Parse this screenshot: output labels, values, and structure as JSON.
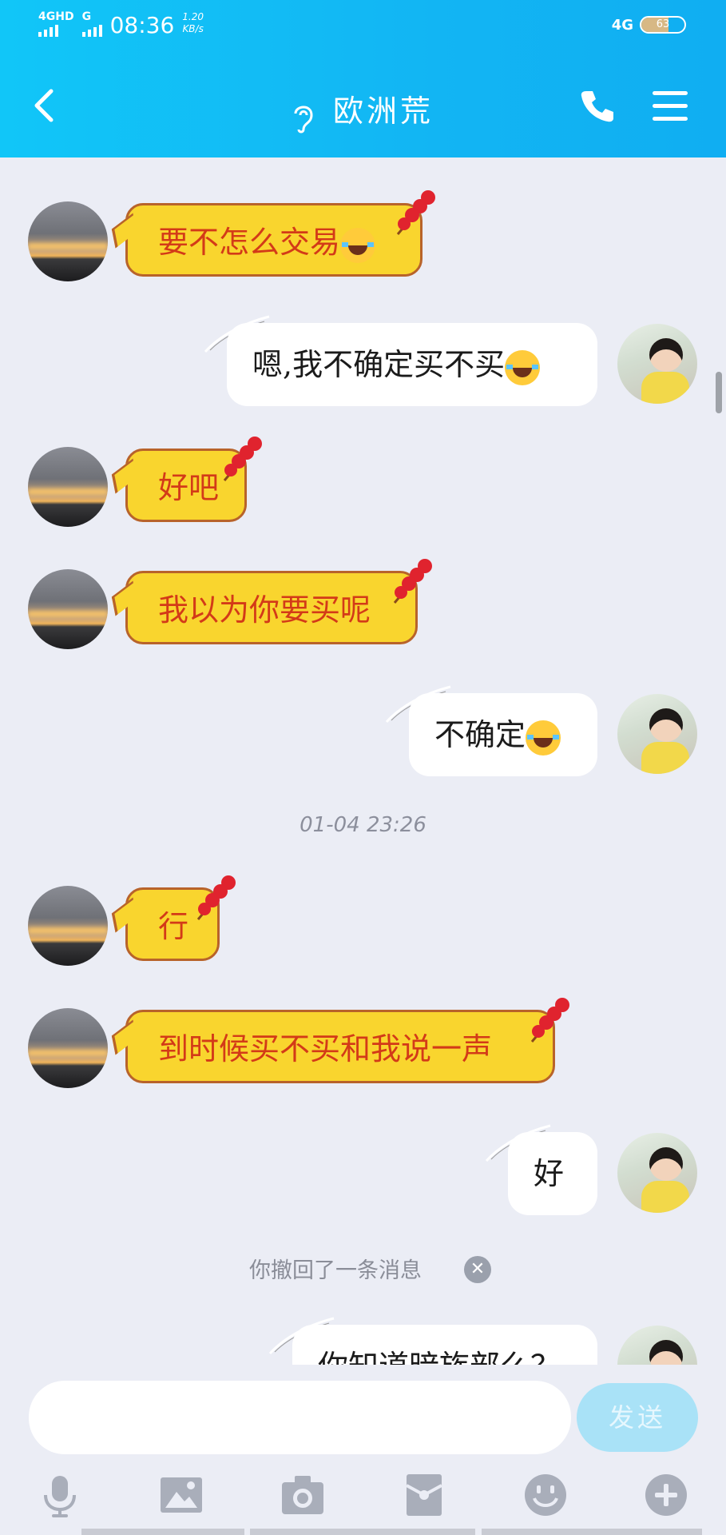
{
  "status_bar": {
    "network_left": "4GHD",
    "network_left2": "G",
    "time": "08:36",
    "speed_value": "1.20",
    "speed_unit": "KB/s",
    "network_right": "4G",
    "battery": "63"
  },
  "header": {
    "title": "欧洲荒"
  },
  "messages": [
    {
      "side": "left",
      "text": "要不怎么交易"
    },
    {
      "side": "right",
      "text": "嗯,我不确定买不买"
    },
    {
      "side": "left",
      "text": "好吧"
    },
    {
      "side": "left",
      "text": "我以为你要买呢"
    },
    {
      "side": "right",
      "text": "不确定"
    },
    {
      "side": "left",
      "text": "行"
    },
    {
      "side": "left",
      "text": "到时候买不买和我说一声"
    },
    {
      "side": "right",
      "text": "好"
    },
    {
      "side": "right",
      "text": "你知道暗族部么？"
    }
  ],
  "timestamp": "01-04 23:26",
  "recall_notice": "你撤回了一条消息",
  "input": {
    "placeholder": "",
    "send_label": "发送"
  },
  "colors": {
    "header_bg": "#12b5f3",
    "bubble_left_bg": "#f9d52e",
    "bubble_left_text": "#d33a18",
    "bubble_right_bg": "#ffffff",
    "send_button": "#a9e2f7"
  },
  "toolbar_icons": [
    "microphone-icon",
    "image-icon",
    "camera-icon",
    "red-packet-icon",
    "emoji-icon",
    "plus-icon"
  ]
}
